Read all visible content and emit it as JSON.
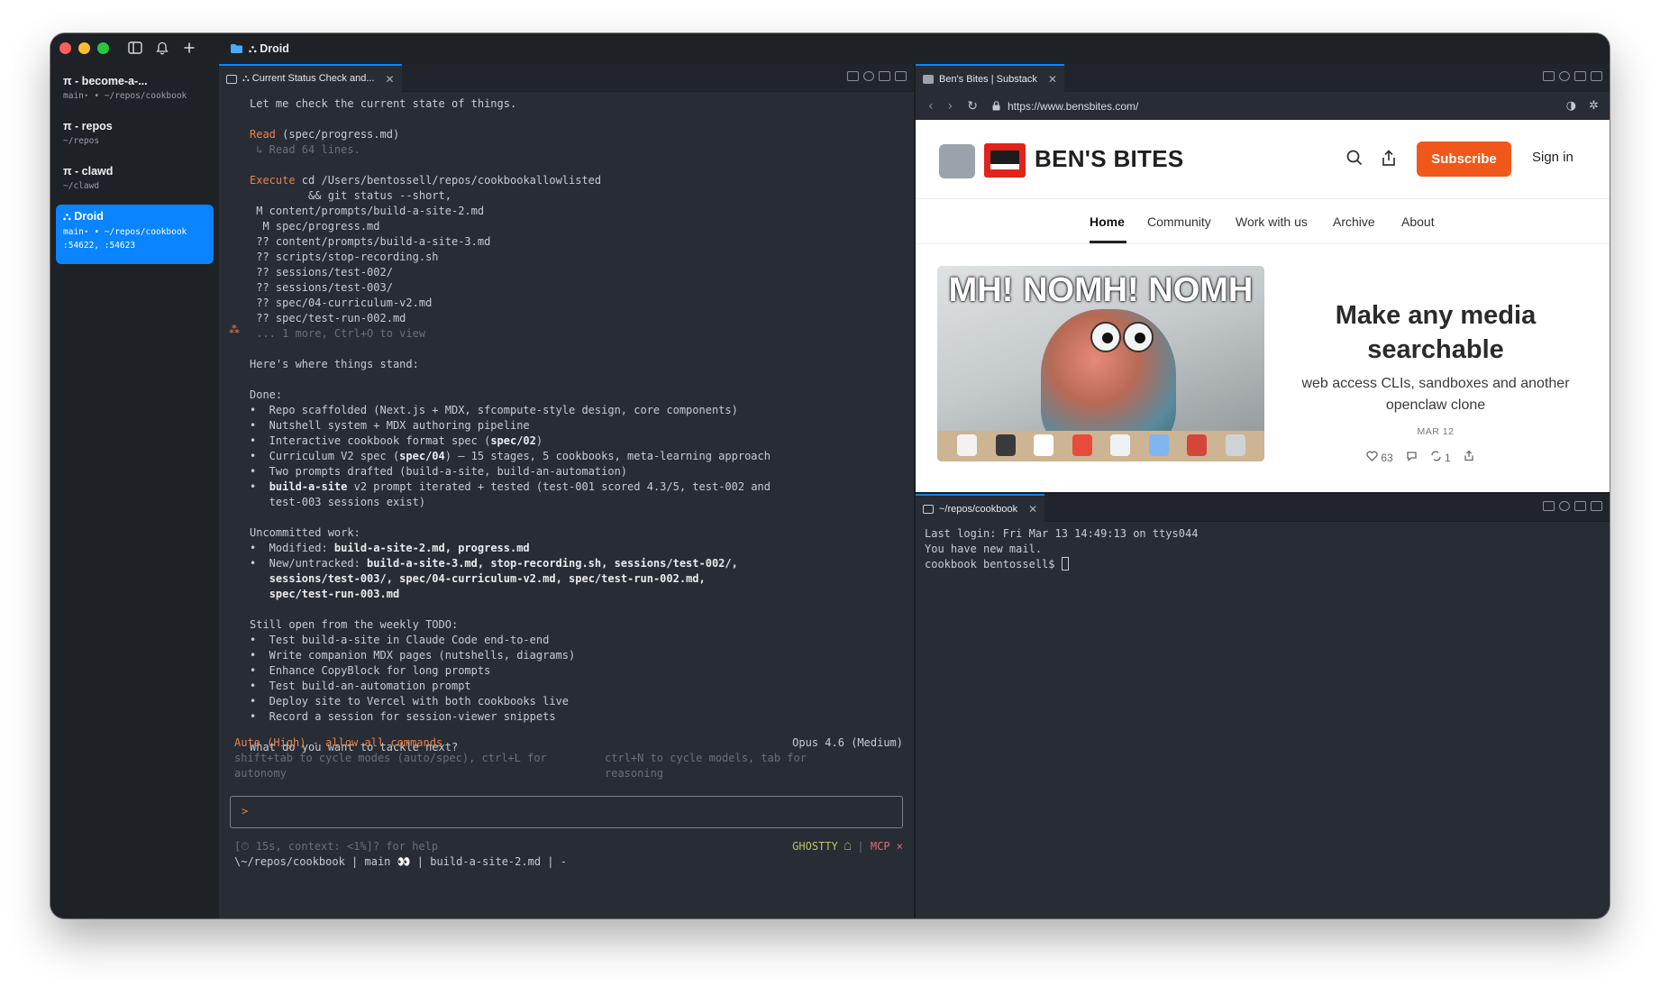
{
  "sidebar": {
    "workspaces": [
      {
        "title": "π - become-a-...",
        "sub": "main⋆ • ~/repos/cookbook"
      },
      {
        "title": "π - repos",
        "sub": "~/repos"
      },
      {
        "title": "π - clawd",
        "sub": "~/clawd"
      },
      {
        "title": "⛬ Droid",
        "sub": "main⋆ • ~/repos/cookbook",
        "sub2": ":54622, :54623"
      }
    ]
  },
  "topbar": {
    "title": "⛬ Droid"
  },
  "left_pane": {
    "tab_label": "⛬ Current Status Check and...",
    "lines": {
      "l1": "Let me check the current state of things.",
      "l2_kw": "Read",
      "l2_rest": " (spec/progress.md)",
      "l3": " ↳ Read 64 lines.",
      "l4_kw": "Execute",
      "l4_rest": " cd /Users/bentossell/repos/cookbookallowlisted",
      "l5": "         && git status --short,",
      "g1": " M content/prompts/build-a-site-2.md",
      "g2": "  M spec/progress.md",
      "g3": " ?? content/prompts/build-a-site-3.md",
      "g4": " ?? scripts/stop-recording.sh",
      "g5": " ?? sessions/test-002/",
      "g6": " ?? sessions/test-003/",
      "g7": " ?? spec/04-curriculum-v2.md",
      "g8": " ?? spec/test-run-002.md",
      "g9": " ... 1 more, Ctrl+O to view",
      "stand_mark": "⁂",
      "stand": "Here's where things stand:",
      "done_h": "Done:",
      "d1": "•  Repo scaffolded (Next.js + MDX, sfcompute-style design, core components)",
      "d2": "•  Nutshell system + MDX authoring pipeline",
      "d3a": "•  Interactive cookbook format spec (",
      "d3b": "spec/02",
      "d3c": ")",
      "d4a": "•  Curriculum V2 spec (",
      "d4b": "spec/04",
      "d4c": ") — 15 stages, 5 cookbooks, meta-learning approach",
      "d5": "•  Two prompts drafted (build-a-site, build-an-automation)",
      "d6a": "•  ",
      "d6b": "build-a-site",
      "d6c": " v2 prompt iterated + tested (test-001 scored 4.3/5, test-002 and",
      "d6d": "   test-003 sessions exist)",
      "unc_h": "Uncommitted work:",
      "u1a": "•  Modified: ",
      "u1b": "build-a-site-2.md, progress.md",
      "u2a": "•  New/untracked: ",
      "u2b": "build-a-site-3.md, stop-recording.sh, sessions/test-002/,",
      "u2c": "sessions/test-003/, spec/04-curriculum-v2.md, spec/test-run-002.md,",
      "u2d": "spec/test-run-003.md",
      "todo_h": "Still open from the weekly TODO:",
      "t1": "•  Test build-a-site in Claude Code end-to-end",
      "t2": "•  Write companion MDX pages (nutshells, diagrams)",
      "t3": "•  Enhance CopyBlock for long prompts",
      "t4": "•  Test build-an-automation prompt",
      "t5": "•  Deploy site to Vercel with both cookbooks live",
      "t6": "•  Record a session for session-viewer snippets",
      "ask": "What do you want to tackle next?"
    },
    "status": {
      "mode": "Auto (High) - allow all commands",
      "mode_hint1": "shift+tab to cycle modes (auto/spec), ctrl+L for",
      "mode_hint2": "autonomy",
      "model": "Opus 4.6 (Medium)",
      "model_hint1": "ctrl+N to cycle models, tab for",
      "model_hint2": "reasoning"
    },
    "prompt": ">",
    "footer_l1": "[⏱ 15s, context: <1%]? for help",
    "footer_l2": "\\~/repos/cookbook | main 👀 | build-a-site-2.md | -",
    "footer_ghostty": "GHOSTTY ☖",
    "footer_sep": " | ",
    "footer_mcp": "MCP ×"
  },
  "browser": {
    "tab_label": "Ben's Bites | Substack",
    "url": "https://www.bensbites.com/",
    "site_name": "BEN'S BITES",
    "subscribe": "Subscribe",
    "sign_in": "Sign in",
    "nav": [
      "Home",
      "Community",
      "Work with us",
      "Archive",
      "About"
    ],
    "hero_caption": "MH! NOMH! NOMH",
    "post_title": "Make any media searchable",
    "post_subtitle": "web access CLIs, sandboxes and another openclaw clone",
    "post_date": "MAR 12",
    "likes": "63",
    "restacks": "1"
  },
  "br_terminal": {
    "tab_label": "~/repos/cookbook",
    "l1": "Last login: Fri Mar 13 14:49:13 on ttys044",
    "l2": "You have new mail.",
    "l3": "cookbook bentossell$ "
  },
  "colors": {
    "accent": "#0a84ff",
    "orange": "#e8834a",
    "subscribe": "#f0581a"
  }
}
